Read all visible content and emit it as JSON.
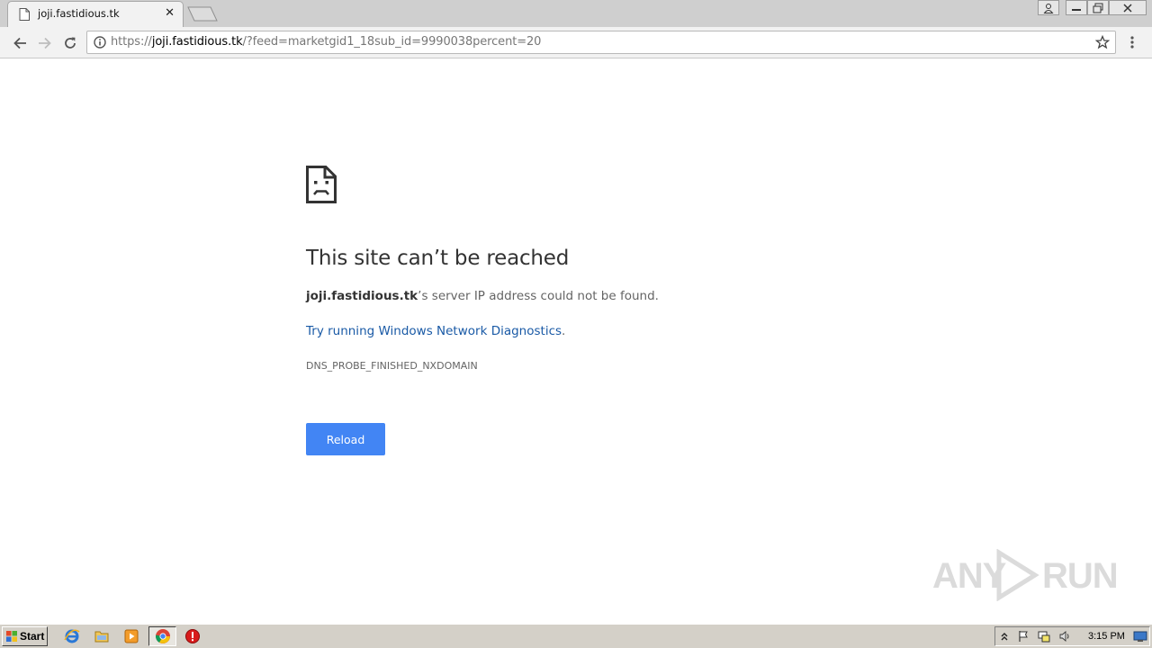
{
  "browser": {
    "tab": {
      "title": "joji.fastidious.tk",
      "favicon": "page-icon",
      "close_icon": "close-icon"
    },
    "address_bar": {
      "scheme": "https://",
      "host": "joji.fastidious.tk",
      "path": "/?feed=marketgid1_18sub_id=9990038percent=20",
      "info_icon": "info-icon",
      "bookmark_icon": "star-icon"
    },
    "nav": {
      "back_icon": "back-arrow-icon",
      "forward_icon": "forward-arrow-icon",
      "reload_icon": "reload-icon",
      "menu_icon": "kebab-menu-icon"
    },
    "window_controls": [
      "user-icon",
      "minimize-icon",
      "restore-icon",
      "close-icon"
    ]
  },
  "error_page": {
    "icon": "sad-page-icon",
    "title": "This site can’t be reached",
    "host": "joji.fastidious.tk",
    "message_suffix": "’s server IP address could not be found.",
    "diagnostics_link": "Try running Windows Network Diagnostics",
    "diagnostics_period": ".",
    "error_code": "DNS_PROBE_FINISHED_NXDOMAIN",
    "reload_label": "Reload",
    "reload_color": "#4285f4"
  },
  "watermark": {
    "left": "ANY",
    "right": "RUN"
  },
  "taskbar": {
    "start_label": "Start",
    "pinned": [
      "internet-explorer-icon",
      "folder-icon",
      "media-player-icon",
      "chrome-icon",
      "stop-icon"
    ],
    "tray": [
      "show-hidden-icon",
      "flag-icon",
      "network-icon",
      "volume-icon"
    ],
    "clock": "3:15 PM",
    "desktop_icon": "show-desktop-icon"
  }
}
